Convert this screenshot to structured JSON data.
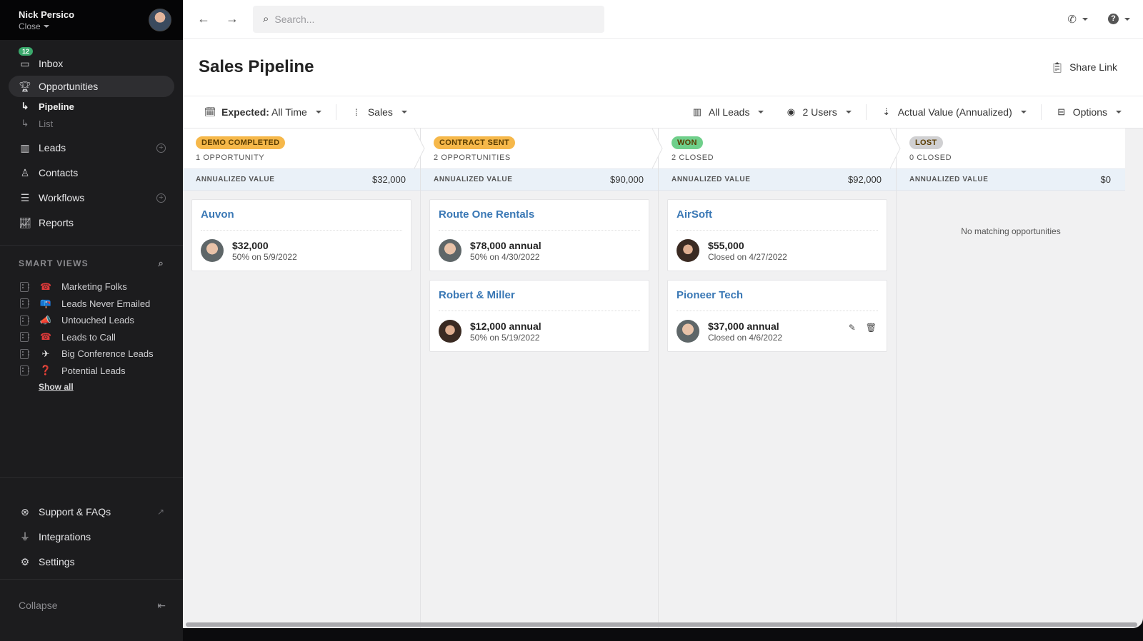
{
  "user": {
    "name": "Nick Persico",
    "org": "Close"
  },
  "sidebar": {
    "inbox": {
      "label": "Inbox",
      "badge": "12"
    },
    "nav": [
      {
        "label": "Opportunities",
        "icon": "trophy-icon"
      }
    ],
    "sub": [
      {
        "label": "Pipeline"
      },
      {
        "label": "List"
      }
    ],
    "nav2": [
      {
        "label": "Leads",
        "icon": "building-icon"
      },
      {
        "label": "Contacts",
        "icon": "user-icon"
      },
      {
        "label": "Workflows",
        "icon": "workflow-icon"
      },
      {
        "label": "Reports",
        "icon": "chart-icon"
      }
    ],
    "smart_views_title": "SMART VIEWS",
    "smart_views": [
      {
        "label": "Marketing Folks",
        "emoji": "☎"
      },
      {
        "label": "Leads Never Emailed",
        "emoji": "📪"
      },
      {
        "label": "Untouched Leads",
        "emoji": "📣"
      },
      {
        "label": "Leads to Call",
        "emoji": "☎"
      },
      {
        "label": "Big Conference Leads",
        "emoji": "✈"
      },
      {
        "label": "Potential Leads",
        "emoji": "❓"
      }
    ],
    "show_all": "Show all",
    "bottom": [
      {
        "label": "Support & FAQs",
        "icon": "lifebuoy-icon"
      },
      {
        "label": "Integrations",
        "icon": "plug-icon"
      },
      {
        "label": "Settings",
        "icon": "gear-icon"
      }
    ],
    "collapse": "Collapse"
  },
  "topbar": {
    "search_placeholder": "Search..."
  },
  "header": {
    "title": "Sales Pipeline",
    "share_link": "Share Link"
  },
  "filters": {
    "expected_label": "Expected:",
    "expected_value": "All Time",
    "pipeline": "Sales",
    "leads": "All Leads",
    "users": "2 Users",
    "sort": "Actual Value (Annualized)",
    "options": "Options"
  },
  "value_label": "ANNUALIZED VALUE",
  "columns": [
    {
      "stage": "DEMO COMPLETED",
      "color": "#f6b84a",
      "count": "1 OPPORTUNITY",
      "value": "$32,000",
      "cards": [
        {
          "company": "Auvon",
          "amount": "$32,000",
          "sub": "50% on 5/9/2022",
          "avatar": "m"
        }
      ]
    },
    {
      "stage": "CONTRACT SENT",
      "color": "#f6b84a",
      "count": "2 OPPORTUNITIES",
      "value": "$90,000",
      "cards": [
        {
          "company": "Route One Rentals",
          "amount": "$78,000 annual",
          "sub": "50% on 4/30/2022",
          "avatar": "m"
        },
        {
          "company": "Robert & Miller",
          "amount": "$12,000 annual",
          "sub": "50% on 5/19/2022",
          "avatar": "f"
        }
      ]
    },
    {
      "stage": "WON",
      "color": "#6fcf8a",
      "count": "2 CLOSED",
      "value": "$92,000",
      "cards": [
        {
          "company": "AirSoft",
          "amount": "$55,000",
          "sub": "Closed on 4/27/2022",
          "avatar": "f"
        },
        {
          "company": "Pioneer Tech",
          "amount": "$37,000 annual",
          "sub": "Closed on 4/6/2022",
          "avatar": "m",
          "hover": true
        }
      ]
    },
    {
      "stage": "LOST",
      "color": "#d0d0d2",
      "count": "0 CLOSED",
      "value": "$0",
      "cards": [],
      "empty": "No matching opportunities"
    }
  ]
}
